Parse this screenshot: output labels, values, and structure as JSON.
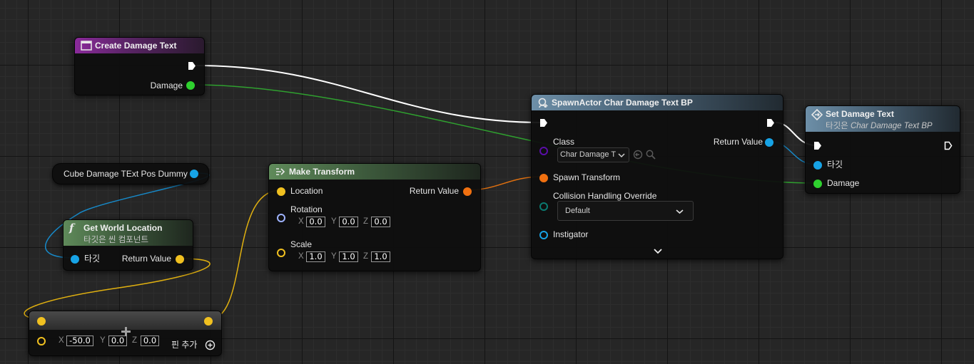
{
  "graph": {
    "colors": {
      "exec": "#ffffff",
      "int_green": "#2fd12f",
      "object_blue": "#17a3e6",
      "vector_yellow": "#f0c020",
      "transform_orange": "#f07010",
      "class_purple": "#5a0ea8",
      "rotator": "#9fb3ff",
      "enum_teal": "#0a7a70"
    },
    "nodes": {
      "create_damage_text": {
        "title": "Create Damage Text",
        "icon": "event-icon",
        "pins": {
          "damage": "Damage"
        }
      },
      "cube_dummy": {
        "label": "Cube Damage TExt Pos Dummy"
      },
      "get_world_location": {
        "title": "Get World Location",
        "subtitle": "타깃은 씬 컴포넌트",
        "icon": "function-icon",
        "pins": {
          "target": "타깃",
          "return_value": "Return Value"
        }
      },
      "make_transform": {
        "title": "Make Transform",
        "icon": "make-struct-icon",
        "pins": {
          "location": "Location",
          "rotation": "Rotation",
          "scale": "Scale",
          "return_value": "Return Value"
        },
        "rotation": {
          "x": "0.0",
          "y": "0.0",
          "z": "0.0"
        },
        "scale": {
          "x": "1.0",
          "y": "1.0",
          "z": "1.0"
        }
      },
      "add_vector": {
        "x": "-50.0",
        "y": "0.0",
        "z": "0.0",
        "add_pin": "핀 추가"
      },
      "spawn_actor": {
        "title": "SpawnActor Char Damage Text BP",
        "icon": "spawn-icon",
        "pins": {
          "class": "Class",
          "return_value": "Return Value",
          "spawn_transform": "Spawn Transform",
          "collision": "Collision Handling Override",
          "instigator": "Instigator"
        },
        "class_value": "Char Damage T",
        "collision_value": "Default"
      },
      "set_damage_text": {
        "title": "Set Damage Text",
        "subtitle_prefix": "타깃은 ",
        "subtitle_target": "Char Damage Text BP",
        "icon": "variable-set-icon",
        "pins": {
          "target": "타깃",
          "damage": "Damage"
        }
      }
    },
    "axis_labels": {
      "x": "X",
      "y": "Y",
      "z": "Z"
    }
  }
}
